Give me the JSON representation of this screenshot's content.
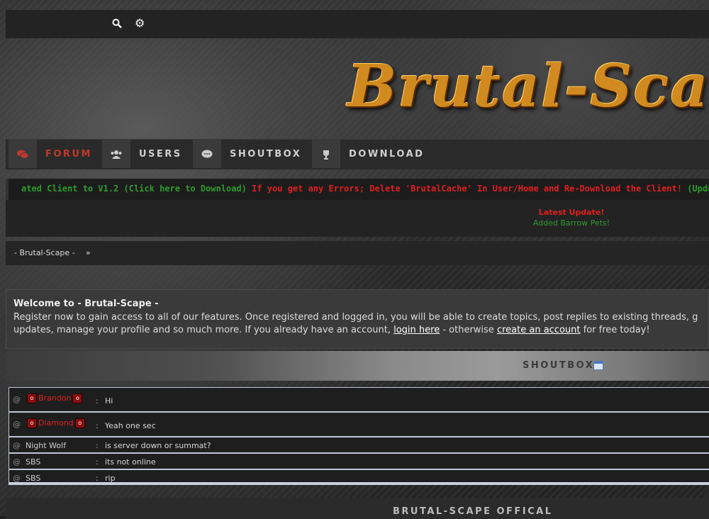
{
  "topbar": {
    "search_icon": "search-icon",
    "settings_icon": "gear-icon"
  },
  "banner": {
    "logo_text": "Brutal-Scape"
  },
  "nav": {
    "items": [
      {
        "label": "FORUM",
        "icon": "comments-icon"
      },
      {
        "label": "USERS",
        "icon": "users-icon"
      },
      {
        "label": "SHOUTBOX",
        "icon": "chat-bubble-icon"
      },
      {
        "label": "DOWNLOAD",
        "icon": "trophy-icon"
      }
    ],
    "active": "FORUM"
  },
  "ticker": {
    "green_1": "ated Client to V1.2 (Click here to Download)",
    "red_1": " If you get any Errors; Delete 'BrutalCache' In User/Home and Re-Download the Client!",
    "green_2": " (Updated: S"
  },
  "latest_update": {
    "title": "Latest Update!",
    "text": "Added Barrow Pets!"
  },
  "breadcrumb": {
    "home": "- Brutal-Scape -",
    "separator": "»"
  },
  "welcome": {
    "title": "Welcome to - Brutal-Scape -",
    "line1": "Register now to gain access to all of our features. Once registered and logged in, you will be able to create topics, post replies to existing threads, g",
    "line2_pre": "updates, manage your profile and so much more. If you already have an account, ",
    "login_link": "login here",
    "line2_mid": " - otherwise ",
    "register_link": "create an account",
    "line2_post": " for free today!"
  },
  "shoutbox": {
    "title": "SHOUTBOX",
    "rows": [
      {
        "at": "@",
        "user": "Brandon",
        "sep": ":",
        "message": "Hi"
      },
      {
        "at": "@",
        "user": "Diamond",
        "sep": ":",
        "message": "Yeah one sec"
      },
      {
        "at": "@",
        "user": "Night Wolf",
        "sep": ":",
        "message": "is server down or summat?"
      },
      {
        "at": "@",
        "user": "SBS",
        "sep": ":",
        "message": "its not online"
      },
      {
        "at": "@",
        "user": "SBS",
        "sep": ":",
        "message": "rip"
      }
    ],
    "rank_icon_text": "o"
  },
  "footer": {
    "title": "BRUTAL-SCAPE OFFICAL"
  },
  "colors": {
    "accent_red": "#c0392b",
    "ticker_green": "#2f9a2f",
    "ticker_red": "#e01f1f"
  }
}
